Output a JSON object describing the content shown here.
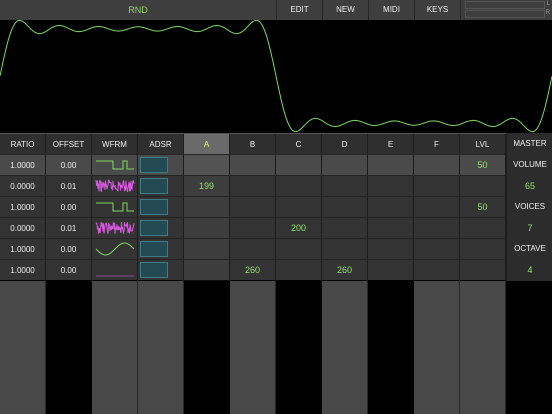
{
  "topbar": {
    "title": "RND",
    "buttons": [
      "EDIT",
      "NEW",
      "MIDI",
      "KEYS"
    ],
    "meter_labels": [
      "L",
      "R"
    ]
  },
  "grid": {
    "headers": [
      "RATIO",
      "OFFSET",
      "WFRM",
      "ADSR",
      "A",
      "B",
      "C",
      "D",
      "E",
      "F",
      "LVL"
    ],
    "selected_header": "A",
    "rows": [
      {
        "ratio": "1.0000",
        "offset": "0.00",
        "wave": "square",
        "a": "",
        "b": "",
        "c": "",
        "d": "",
        "e": "",
        "f": "",
        "lvl": "50"
      },
      {
        "ratio": "0.0000",
        "offset": "0.01",
        "wave": "noise",
        "a": "199",
        "b": "",
        "c": "",
        "d": "",
        "e": "",
        "f": "",
        "lvl": ""
      },
      {
        "ratio": "1.0000",
        "offset": "0.00",
        "wave": "square",
        "a": "",
        "b": "",
        "c": "",
        "d": "",
        "e": "",
        "f": "",
        "lvl": "50"
      },
      {
        "ratio": "0.0000",
        "offset": "0.01",
        "wave": "noise",
        "a": "",
        "b": "",
        "c": "200",
        "d": "",
        "e": "",
        "f": "",
        "lvl": ""
      },
      {
        "ratio": "1.0000",
        "offset": "0.00",
        "wave": "sine",
        "a": "",
        "b": "",
        "c": "",
        "d": "",
        "e": "",
        "f": "",
        "lvl": ""
      },
      {
        "ratio": "1.0000",
        "offset": "0.00",
        "wave": "flat",
        "a": "",
        "b": "260",
        "c": "",
        "d": "260",
        "e": "",
        "f": "",
        "lvl": ""
      }
    ]
  },
  "master": {
    "title": "MASTER",
    "volume_label": "VOLUME",
    "volume": "65",
    "voices_label": "VOICES",
    "voices": "7",
    "octave_label": "OCTAVE",
    "octave": "4"
  },
  "colors": {
    "accent_green": "#8fe36d",
    "selected_header_text": "#d9ff6b",
    "waveform_pink": "#d858e0",
    "adsr_teal": "#234a52"
  }
}
